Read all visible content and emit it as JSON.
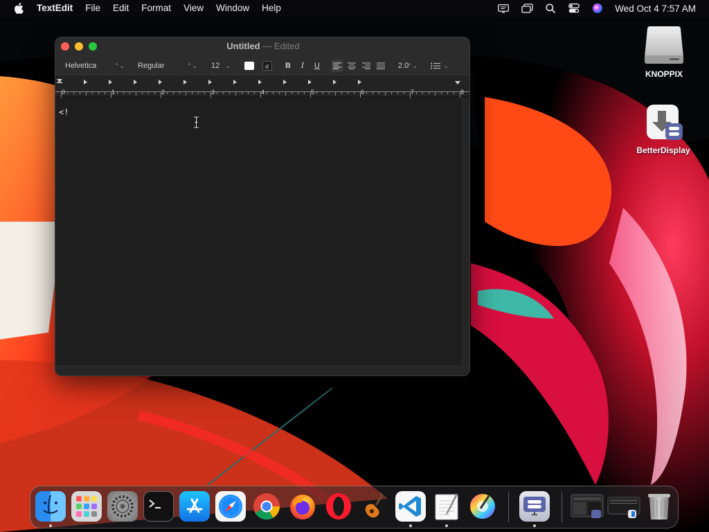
{
  "menubar": {
    "app_name": "TextEdit",
    "menus": [
      "File",
      "Edit",
      "Format",
      "View",
      "Window",
      "Help"
    ],
    "clock": "Wed Oct 4  7:57 AM"
  },
  "desktop": {
    "icons": [
      {
        "label": "KNOPPIX",
        "icon": "disk-drive-icon"
      },
      {
        "label": "BetterDisplay",
        "icon": "installer-download-icon"
      }
    ]
  },
  "window": {
    "title": "Untitled",
    "title_separator": "—",
    "title_status": "Edited",
    "toolbar": {
      "font_family": "Helvetica",
      "font_style": "Regular",
      "font_size": "12",
      "bold": "B",
      "italic": "I",
      "underline": "U",
      "line_spacing": "2.0"
    },
    "ruler_labels": [
      "0",
      "1",
      "2",
      "3",
      "4",
      "5",
      "6",
      "7",
      "8"
    ],
    "document_text": "<!"
  },
  "colors": {
    "close": "#ff5f57",
    "minimize": "#febc2e",
    "zoom": "#28c840"
  },
  "dock": {
    "items": [
      {
        "name": "Finder",
        "icon": "finder-icon"
      },
      {
        "name": "Launchpad",
        "icon": "launchpad-icon"
      },
      {
        "name": "System Settings",
        "icon": "gear-icon"
      },
      {
        "name": "Terminal",
        "icon": "terminal-icon"
      },
      {
        "name": "App Store",
        "icon": "app-store-icon"
      },
      {
        "name": "Safari",
        "icon": "compass-icon"
      },
      {
        "name": "Chrome",
        "icon": "chrome-icon"
      },
      {
        "name": "Firefox",
        "icon": "firefox-icon"
      },
      {
        "name": "Opera",
        "icon": "opera-icon"
      },
      {
        "name": "GarageBand",
        "icon": "guitar-icon"
      },
      {
        "name": "VS Code",
        "icon": "vscode-icon"
      },
      {
        "name": "TextEdit",
        "icon": "textedit-icon"
      },
      {
        "name": "Color Picker",
        "icon": "color-wheel-icon"
      },
      {
        "name": "BetterDisplay",
        "icon": "display-settings-icon"
      },
      {
        "name": "Window 1",
        "icon": "window-thumbnail-icon"
      },
      {
        "name": "Window 2",
        "icon": "window-thumbnail-icon"
      },
      {
        "name": "Trash",
        "icon": "trash-icon"
      }
    ]
  }
}
